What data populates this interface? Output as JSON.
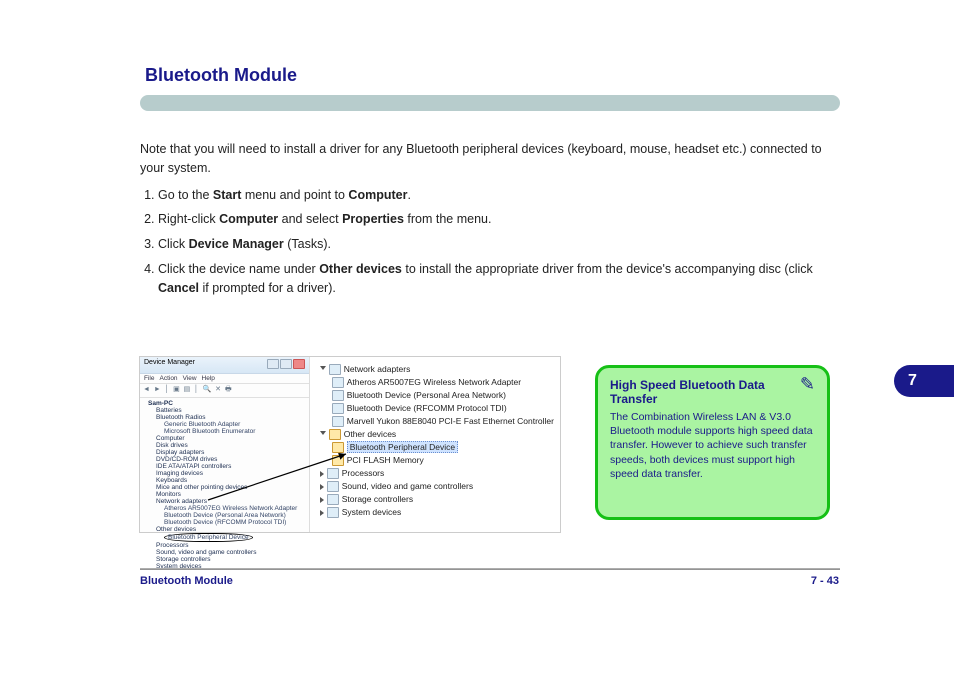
{
  "header": {
    "section_title": "Bluetooth Module"
  },
  "body": {
    "intro": "Note that you will need to install a driver for any Bluetooth peripheral devices (keyboard, mouse, headset etc.) connected to your system.",
    "steps": [
      {
        "pre": "Go to the ",
        "b1": "Start",
        "mid": " menu and point to ",
        "b2": "Computer",
        "post": "."
      },
      {
        "pre": "Right-click ",
        "b1": "Computer",
        "mid": " and select ",
        "b2": "Properties",
        "post": " from the menu."
      },
      {
        "pre": "Click ",
        "b1": "Device Manager",
        "post": " (Tasks)."
      },
      {
        "pre": "Click the device name under ",
        "b1": "Other devices",
        "mid": " to install the appropriate driver from the device's accompanying disc (click ",
        "b2": "Cancel",
        "post": " if prompted for a driver)."
      }
    ]
  },
  "device_manager": {
    "window_title": "Device Manager",
    "menu": [
      "File",
      "Action",
      "View",
      "Help"
    ],
    "left_tree": {
      "root": "Sam-PC",
      "nodes": [
        "Batteries",
        "Bluetooth Radios",
        "  Generic Bluetooth Adapter",
        "  Microsoft Bluetooth Enumerator",
        "Computer",
        "Disk drives",
        "Display adapters",
        "DVD/CD-ROM drives",
        "IDE ATA/ATAPI controllers",
        "Imaging devices",
        "Keyboards",
        "Mice and other pointing devices",
        "Monitors",
        "Network adapters",
        "  Atheros AR5007EG Wireless Network Adapter",
        "  Bluetooth Device (Personal Area Network)",
        "  Bluetooth Device (RFCOMM Protocol TDI)",
        "Other devices",
        "  Bluetooth Peripheral Device",
        "Processors",
        "Sound, video and game controllers",
        "Storage controllers",
        "System devices"
      ]
    },
    "right_detail": {
      "groups": [
        {
          "label": "Network adapters",
          "children": [
            "Atheros AR5007EG Wireless Network Adapter",
            "Bluetooth Device (Personal Area Network)",
            "Bluetooth Device (RFCOMM Protocol TDI)",
            "Marvell Yukon 88E8040 PCI-E Fast Ethernet Controller"
          ]
        },
        {
          "label": "Other devices",
          "children_warn": [
            "Bluetooth Peripheral Device",
            "PCI FLASH Memory"
          ]
        },
        {
          "label": "Processors"
        },
        {
          "label": "Sound, video and game controllers"
        },
        {
          "label": "Storage controllers"
        },
        {
          "label": "System devices"
        }
      ],
      "highlighted": "Bluetooth Peripheral Device"
    }
  },
  "note": {
    "title": "High Speed Bluetooth Data Transfer",
    "body": "The Combination Wireless LAN & V3.0 Bluetooth module supports high speed data transfer. However to achieve such transfer speeds, both devices must support high speed data transfer."
  },
  "side_tab": "7",
  "footer": {
    "left": "Bluetooth Module",
    "right": "7 - 43"
  }
}
